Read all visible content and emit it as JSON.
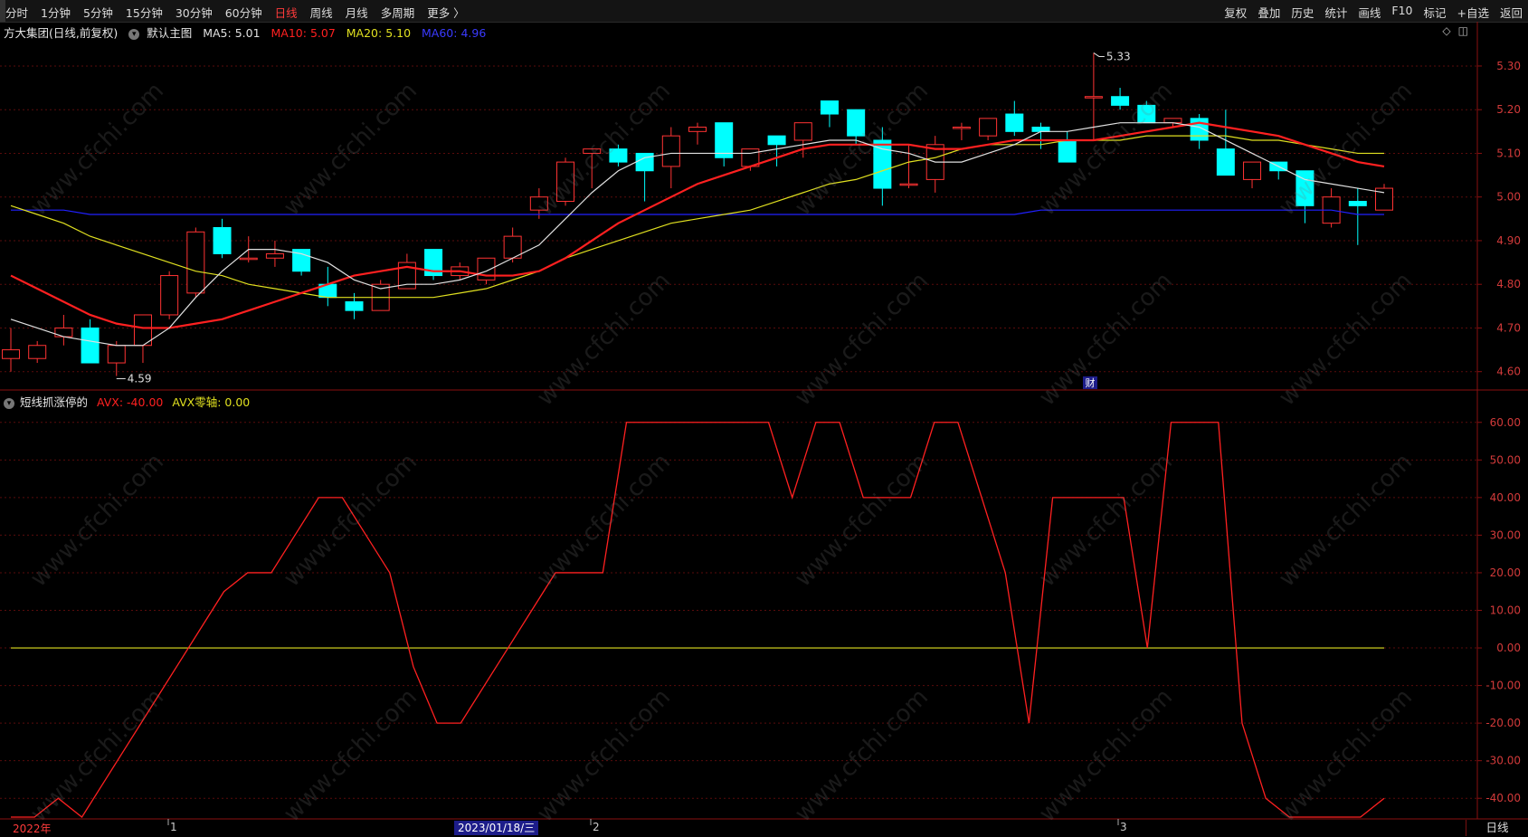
{
  "toolbar": {
    "periods": [
      "分时",
      "1分钟",
      "5分钟",
      "15分钟",
      "30分钟",
      "60分钟",
      "日线",
      "周线",
      "月线",
      "多周期",
      "更多 〉"
    ],
    "active_period": "日线",
    "right_items": [
      "复权",
      "叠加",
      "历史",
      "统计",
      "画线",
      "F10",
      "标记",
      "+自选",
      "返回"
    ]
  },
  "main_chart": {
    "stock_title": "方大集团(日线,前复权)",
    "template": "默认主图",
    "ma5_label": "MA5: 5.01",
    "ma10_label": "MA10: 5.07",
    "ma20_label": "MA20: 5.10",
    "ma60_label": "MA60: 4.96",
    "high_marker": "5.33",
    "low_marker": "4.59",
    "event_badge": "财",
    "y_ticks": [
      "5.30",
      "5.20",
      "5.10",
      "5.00",
      "4.90",
      "4.80",
      "4.70",
      "4.60"
    ]
  },
  "sub_chart": {
    "indicator_name": "短线抓涨停的",
    "avx_label": "AVX: -40.00",
    "avx_zero_label": "AVX零轴: 0.00",
    "y_ticks": [
      "60.00",
      "50.00",
      "40.00",
      "30.00",
      "20.00",
      "10.00",
      "0.00",
      "-10.00",
      "-20.00",
      "-30.00",
      "-40.00"
    ]
  },
  "bottom_axis": {
    "year_label": "2022年",
    "month_1": "1",
    "month_2": "2",
    "month_3": "3",
    "cursor_date": "2023/01/18/三",
    "period_button": "日线"
  },
  "watermark_text": "www.cfchi.com",
  "colors": {
    "up": "#ff3333",
    "down": "#00ffff",
    "ma5": "#e0e0e0",
    "ma10": "#ff2020",
    "ma20": "#e0e020",
    "ma60": "#2020ff",
    "avx": "#ff2020",
    "zero_axis": "#e0e020"
  },
  "chart_data": [
    {
      "type": "candlestick",
      "title": "方大集团(日线,前复权)",
      "y_range": [
        4.56,
        5.36
      ],
      "candles": [
        {
          "o": 4.63,
          "h": 4.7,
          "l": 4.6,
          "c": 4.65
        },
        {
          "o": 4.63,
          "h": 4.67,
          "l": 4.62,
          "c": 4.66
        },
        {
          "o": 4.68,
          "h": 4.73,
          "l": 4.66,
          "c": 4.7
        },
        {
          "o": 4.7,
          "h": 4.72,
          "l": 4.62,
          "c": 4.62
        },
        {
          "o": 4.62,
          "h": 4.67,
          "l": 4.59,
          "c": 4.66
        },
        {
          "o": 4.66,
          "h": 4.73,
          "l": 4.62,
          "c": 4.73
        },
        {
          "o": 4.73,
          "h": 4.83,
          "l": 4.72,
          "c": 4.82
        },
        {
          "o": 4.78,
          "h": 4.93,
          "l": 4.77,
          "c": 4.92
        },
        {
          "o": 4.93,
          "h": 4.95,
          "l": 4.86,
          "c": 4.87
        },
        {
          "o": 4.86,
          "h": 4.91,
          "l": 4.85,
          "c": 4.86
        },
        {
          "o": 4.86,
          "h": 4.9,
          "l": 4.84,
          "c": 4.87
        },
        {
          "o": 4.88,
          "h": 4.88,
          "l": 4.82,
          "c": 4.83
        },
        {
          "o": 4.8,
          "h": 4.84,
          "l": 4.75,
          "c": 4.77
        },
        {
          "o": 4.76,
          "h": 4.78,
          "l": 4.72,
          "c": 4.74
        },
        {
          "o": 4.74,
          "h": 4.81,
          "l": 4.74,
          "c": 4.8
        },
        {
          "o": 4.79,
          "h": 4.87,
          "l": 4.79,
          "c": 4.85
        },
        {
          "o": 4.88,
          "h": 4.88,
          "l": 4.81,
          "c": 4.82
        },
        {
          "o": 4.82,
          "h": 4.85,
          "l": 4.81,
          "c": 4.84
        },
        {
          "o": 4.81,
          "h": 4.86,
          "l": 4.8,
          "c": 4.86
        },
        {
          "o": 4.86,
          "h": 4.93,
          "l": 4.85,
          "c": 4.91
        },
        {
          "o": 4.97,
          "h": 5.02,
          "l": 4.95,
          "c": 5.0
        },
        {
          "o": 4.99,
          "h": 5.09,
          "l": 4.98,
          "c": 5.08
        },
        {
          "o": 5.1,
          "h": 5.11,
          "l": 5.02,
          "c": 5.11
        },
        {
          "o": 5.11,
          "h": 5.12,
          "l": 5.07,
          "c": 5.08
        },
        {
          "o": 5.1,
          "h": 5.1,
          "l": 4.99,
          "c": 5.06
        },
        {
          "o": 5.07,
          "h": 5.16,
          "l": 5.02,
          "c": 5.14
        },
        {
          "o": 5.15,
          "h": 5.17,
          "l": 5.12,
          "c": 5.16
        },
        {
          "o": 5.17,
          "h": 5.17,
          "l": 5.07,
          "c": 5.09
        },
        {
          "o": 5.07,
          "h": 5.11,
          "l": 5.06,
          "c": 5.11
        },
        {
          "o": 5.14,
          "h": 5.14,
          "l": 5.07,
          "c": 5.12
        },
        {
          "o": 5.13,
          "h": 5.17,
          "l": 5.09,
          "c": 5.17
        },
        {
          "o": 5.22,
          "h": 5.22,
          "l": 5.16,
          "c": 5.19
        },
        {
          "o": 5.2,
          "h": 5.2,
          "l": 5.12,
          "c": 5.14
        },
        {
          "o": 5.13,
          "h": 5.16,
          "l": 4.98,
          "c": 5.02
        },
        {
          "o": 5.03,
          "h": 5.12,
          "l": 5.02,
          "c": 5.03
        },
        {
          "o": 5.04,
          "h": 5.14,
          "l": 5.01,
          "c": 5.12
        },
        {
          "o": 5.16,
          "h": 5.17,
          "l": 5.13,
          "c": 5.16
        },
        {
          "o": 5.14,
          "h": 5.18,
          "l": 5.13,
          "c": 5.18
        },
        {
          "o": 5.19,
          "h": 5.22,
          "l": 5.14,
          "c": 5.15
        },
        {
          "o": 5.16,
          "h": 5.17,
          "l": 5.11,
          "c": 5.15
        },
        {
          "o": 5.13,
          "h": 5.15,
          "l": 5.08,
          "c": 5.08
        },
        {
          "o": 5.23,
          "h": 5.33,
          "l": 5.13,
          "c": 5.23
        },
        {
          "o": 5.23,
          "h": 5.25,
          "l": 5.2,
          "c": 5.21
        },
        {
          "o": 5.21,
          "h": 5.22,
          "l": 5.17,
          "c": 5.17
        },
        {
          "o": 5.17,
          "h": 5.18,
          "l": 5.16,
          "c": 5.18
        },
        {
          "o": 5.18,
          "h": 5.19,
          "l": 5.11,
          "c": 5.13
        },
        {
          "o": 5.11,
          "h": 5.2,
          "l": 5.05,
          "c": 5.05
        },
        {
          "o": 5.04,
          "h": 5.08,
          "l": 5.02,
          "c": 5.08
        },
        {
          "o": 5.08,
          "h": 5.08,
          "l": 5.04,
          "c": 5.06
        },
        {
          "o": 5.06,
          "h": 5.06,
          "l": 4.94,
          "c": 4.98
        },
        {
          "o": 4.94,
          "h": 5.02,
          "l": 4.93,
          "c": 5.0
        },
        {
          "o": 4.99,
          "h": 5.02,
          "l": 4.89,
          "c": 4.98
        },
        {
          "o": 4.97,
          "h": 5.03,
          "l": 4.97,
          "c": 5.02
        }
      ],
      "ma5": [
        4.72,
        4.7,
        4.68,
        4.67,
        4.66,
        4.66,
        4.7,
        4.77,
        4.83,
        4.88,
        4.88,
        4.87,
        4.85,
        4.81,
        4.79,
        4.8,
        4.8,
        4.81,
        4.83,
        4.86,
        4.89,
        4.95,
        5.01,
        5.06,
        5.09,
        5.1,
        5.1,
        5.1,
        5.1,
        5.11,
        5.12,
        5.13,
        5.13,
        5.11,
        5.1,
        5.08,
        5.08,
        5.1,
        5.12,
        5.15,
        5.15,
        5.16,
        5.17,
        5.17,
        5.17,
        5.16,
        5.13,
        5.1,
        5.07,
        5.04,
        5.03,
        5.02,
        5.01
      ],
      "ma10": [
        4.82,
        4.79,
        4.76,
        4.73,
        4.71,
        4.7,
        4.7,
        4.71,
        4.72,
        4.74,
        4.76,
        4.78,
        4.8,
        4.82,
        4.83,
        4.84,
        4.83,
        4.83,
        4.82,
        4.82,
        4.83,
        4.86,
        4.9,
        4.94,
        4.97,
        5.0,
        5.03,
        5.05,
        5.07,
        5.09,
        5.11,
        5.12,
        5.12,
        5.12,
        5.12,
        5.11,
        5.11,
        5.12,
        5.13,
        5.13,
        5.13,
        5.13,
        5.14,
        5.15,
        5.16,
        5.17,
        5.16,
        5.15,
        5.14,
        5.12,
        5.1,
        5.08,
        5.07
      ],
      "ma20": [
        4.98,
        4.96,
        4.94,
        4.91,
        4.89,
        4.87,
        4.85,
        4.83,
        4.82,
        4.8,
        4.79,
        4.78,
        4.77,
        4.77,
        4.77,
        4.77,
        4.77,
        4.78,
        4.79,
        4.81,
        4.83,
        4.86,
        4.88,
        4.9,
        4.92,
        4.94,
        4.95,
        4.96,
        4.97,
        4.99,
        5.01,
        5.03,
        5.04,
        5.06,
        5.08,
        5.09,
        5.11,
        5.12,
        5.12,
        5.12,
        5.13,
        5.13,
        5.13,
        5.14,
        5.14,
        5.14,
        5.14,
        5.13,
        5.13,
        5.12,
        5.11,
        5.1,
        5.1
      ],
      "ma60": [
        4.97,
        4.97,
        4.97,
        4.96,
        4.96,
        4.96,
        4.96,
        4.96,
        4.96,
        4.96,
        4.96,
        4.96,
        4.96,
        4.96,
        4.96,
        4.96,
        4.96,
        4.96,
        4.96,
        4.96,
        4.96,
        4.96,
        4.96,
        4.96,
        4.96,
        4.96,
        4.96,
        4.96,
        4.96,
        4.96,
        4.96,
        4.96,
        4.96,
        4.96,
        4.96,
        4.96,
        4.96,
        4.96,
        4.96,
        4.97,
        4.97,
        4.97,
        4.97,
        4.97,
        4.97,
        4.97,
        4.97,
        4.97,
        4.97,
        4.97,
        4.97,
        4.96,
        4.96
      ]
    },
    {
      "type": "line",
      "title": "短线抓涨停的",
      "y_range": [
        -45,
        65
      ],
      "series": [
        {
          "name": "AVX",
          "values": [
            -45,
            -45,
            -40,
            -45,
            -35,
            -25,
            -15,
            -5,
            5,
            15,
            20,
            20,
            30,
            40,
            40,
            30,
            20,
            -5,
            -20,
            -20,
            -10,
            0,
            10,
            20,
            20,
            20,
            60,
            60,
            60,
            60,
            60,
            60,
            60,
            40,
            60,
            60,
            40,
            40,
            40,
            60,
            60,
            40,
            20,
            -20,
            40,
            40,
            40,
            40,
            0,
            60,
            60,
            60,
            -20,
            -40,
            -45,
            -45,
            -45,
            -45,
            -40
          ]
        },
        {
          "name": "AVX零轴",
          "values": [
            0
          ]
        }
      ]
    }
  ]
}
